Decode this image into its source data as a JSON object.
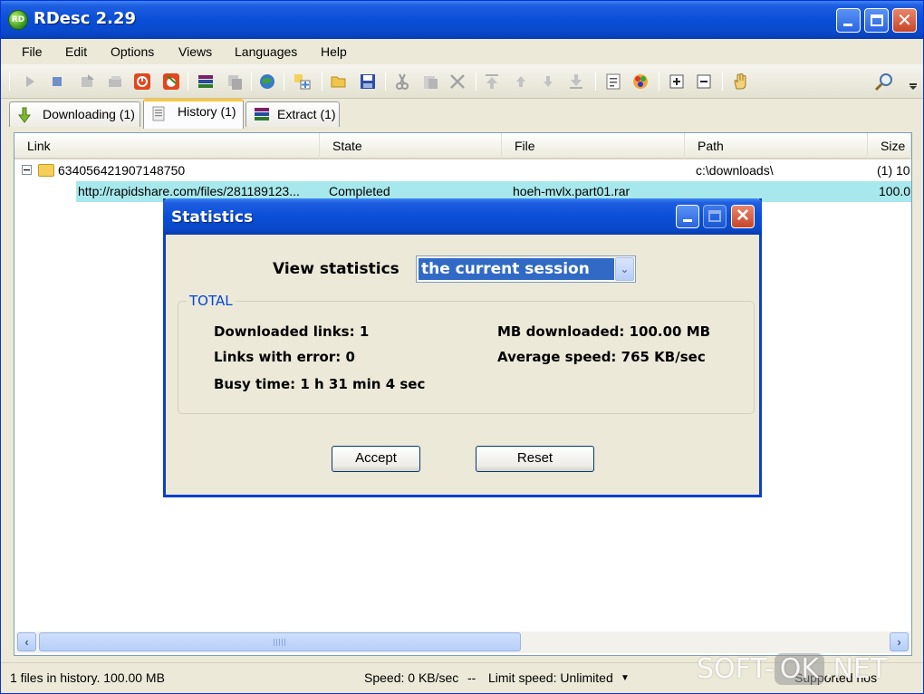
{
  "window": {
    "title": "RDesc 2.29",
    "app_icon": "RD"
  },
  "menu": [
    "File",
    "Edit",
    "Options",
    "Views",
    "Languages",
    "Help"
  ],
  "toolbar_icons": [
    "start-icon",
    "stop-icon",
    "queue-icon",
    "pause-all-icon",
    "stop-all-icon",
    "schedule-icon",
    "extract-icon",
    "copy-icon",
    "globe-icon",
    "add-link-icon",
    "open-folder-icon",
    "save-icon",
    "cut-icon",
    "paste-icon",
    "delete-icon",
    "move-top-icon",
    "move-up-icon",
    "move-down-icon",
    "move-bottom-icon",
    "properties-icon",
    "colors-icon",
    "expand-icon",
    "collapse-icon",
    "hand-icon",
    "search-icon"
  ],
  "tabs": [
    {
      "label": "Downloading (1)",
      "icon": "arrow-down-icon"
    },
    {
      "label": "History (1)",
      "icon": "history-icon"
    },
    {
      "label": "Extract (1)",
      "icon": "winrar-icon"
    }
  ],
  "list": {
    "columns": [
      "Link",
      "State",
      "File",
      "Path",
      "Size"
    ],
    "group": {
      "toggle": "⊟",
      "name": "634056421907148750",
      "path": "c:\\downloads\\",
      "size": "(1) 10"
    },
    "item": {
      "link": "http://rapidshare.com/files/281189123...",
      "state": "Completed",
      "file": "hoeh-mvlx.part01.rar",
      "size": "100.0"
    }
  },
  "statusbar": {
    "files": "1 files in history. 100.00 MB",
    "speed": "Speed: 0 KB/sec",
    "sep": "--",
    "limit": "Limit speed: Unlimited",
    "supported": "Supported hos"
  },
  "dialog": {
    "title": "Statistics",
    "view_label": "View statistics",
    "select_value": "the current session",
    "group_title": "TOTAL",
    "downloaded_links": "Downloaded links: 1",
    "links_error": "Links with error: 0",
    "busy_time": "Busy time: 1 h 31 min 4 sec",
    "mb_downloaded": "MB downloaded: 100.00 MB",
    "avg_speed": "Average speed: 765 KB/sec",
    "accept": "Accept",
    "reset": "Reset"
  },
  "watermark": {
    "left": "SOFT-",
    "mid": "OK",
    "right": ".NET"
  },
  "colors": {
    "title_blue": "#0a4fd8",
    "selection": "#316ac5",
    "row_highlight": "#a7e8ec",
    "group_title": "#0046d5"
  }
}
